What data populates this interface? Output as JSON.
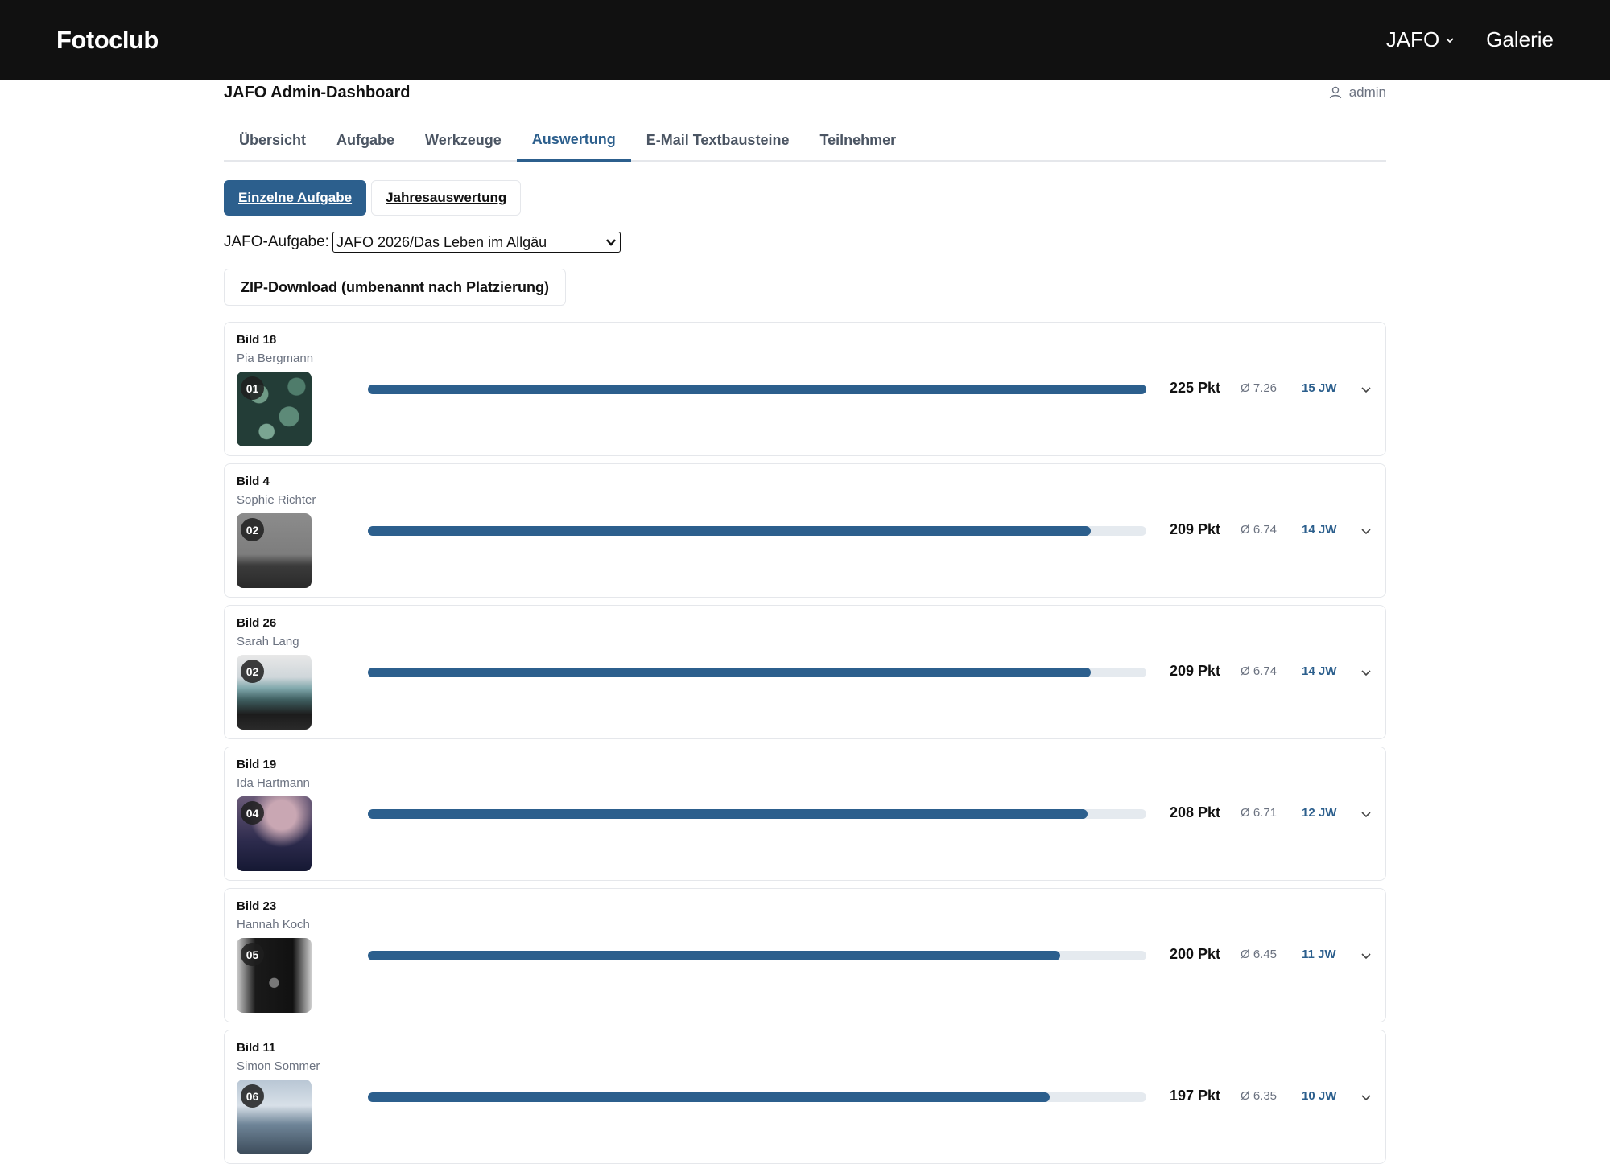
{
  "app": {
    "brand": "Fotoclub"
  },
  "topnav": {
    "jafo_label": "JAFO",
    "galerie_label": "Galerie"
  },
  "dashboard": {
    "title": "JAFO Admin-Dashboard",
    "user": "admin"
  },
  "tabs": [
    {
      "label": "Übersicht"
    },
    {
      "label": "Aufgabe"
    },
    {
      "label": "Werkzeuge"
    },
    {
      "label": "Auswertung",
      "active": true
    },
    {
      "label": "E-Mail Textbausteine"
    },
    {
      "label": "Teilnehmer"
    }
  ],
  "subtabs": [
    {
      "label": "Einzelne Aufgabe",
      "active": true
    },
    {
      "label": "Jahresauswertung"
    }
  ],
  "task": {
    "label": "JAFO-Aufgabe:",
    "selected": "JAFO 2026/Das Leben im Allgäu"
  },
  "zip_button": "ZIP-Download (umbenannt nach Platzierung)",
  "entries": [
    {
      "title": "Bild 18",
      "author": "Pia Bergmann",
      "rank": "01",
      "score": "225 Pkt",
      "avg": "Ø 7.26",
      "jw": "15 JW",
      "progress": 1.0
    },
    {
      "title": "Bild 4",
      "author": "Sophie Richter",
      "rank": "02",
      "score": "209 Pkt",
      "avg": "Ø 6.74",
      "jw": "14 JW",
      "progress": 0.929
    },
    {
      "title": "Bild 26",
      "author": "Sarah Lang",
      "rank": "02",
      "score": "209 Pkt",
      "avg": "Ø 6.74",
      "jw": "14 JW",
      "progress": 0.929
    },
    {
      "title": "Bild 19",
      "author": "Ida Hartmann",
      "rank": "04",
      "score": "208 Pkt",
      "avg": "Ø 6.71",
      "jw": "12 JW",
      "progress": 0.924
    },
    {
      "title": "Bild 23",
      "author": "Hannah Koch",
      "rank": "05",
      "score": "200 Pkt",
      "avg": "Ø 6.45",
      "jw": "11 JW",
      "progress": 0.889
    },
    {
      "title": "Bild 11",
      "author": "Simon Sommer",
      "rank": "06",
      "score": "197 Pkt",
      "avg": "Ø 6.35",
      "jw": "10 JW",
      "progress": 0.876
    }
  ],
  "colors": {
    "accent": "#2c5f8d",
    "topbar": "#111111",
    "track": "#e5eaef"
  }
}
